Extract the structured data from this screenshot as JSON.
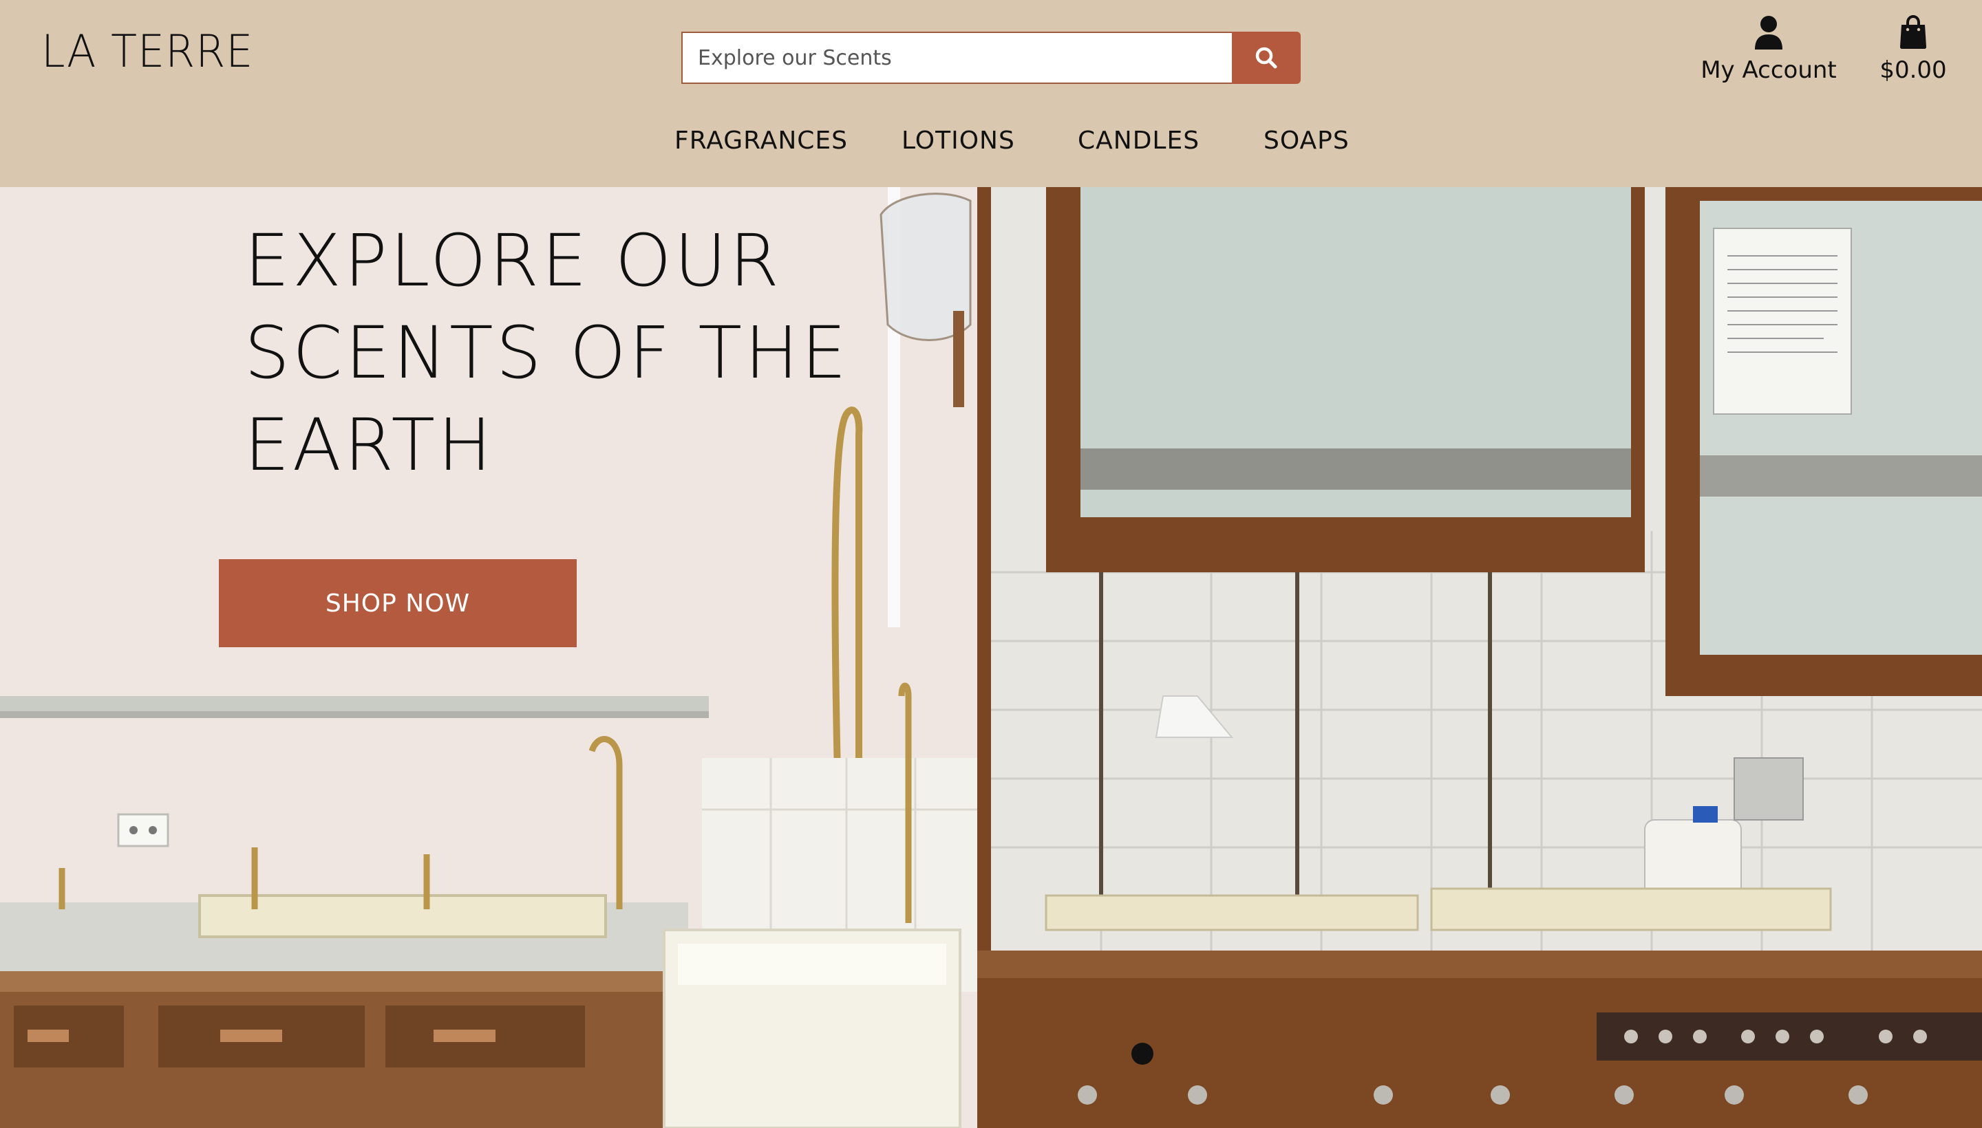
{
  "brand": {
    "logo_text": "LA TERRE"
  },
  "search": {
    "placeholder": "Explore our Scents",
    "button_icon": "search-icon"
  },
  "account": {
    "label": "My Account",
    "icon": "user-icon"
  },
  "cart": {
    "total": "$0.00",
    "icon": "shopping-bag-icon"
  },
  "nav": {
    "items": [
      {
        "label": "FRAGRANCES"
      },
      {
        "label": "LOTIONS"
      },
      {
        "label": "CANDLES"
      },
      {
        "label": "SOAPS"
      }
    ]
  },
  "hero": {
    "title": "EXPLORE OUR\nSCENTS OF THE\nEARTH",
    "cta_label": "SHOP NOW"
  },
  "colors": {
    "header_bg": "#d9c7b0",
    "accent": "#b45a3f",
    "text": "#111111"
  }
}
